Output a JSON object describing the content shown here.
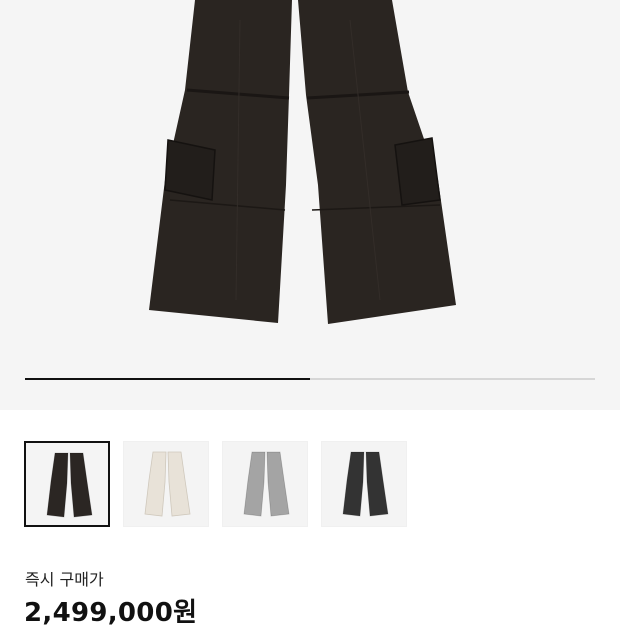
{
  "product": {
    "image_carousel": {
      "progress": 0.5
    },
    "thumbnails": [
      {
        "color_name": "black",
        "color": "#2b2623",
        "selected": true
      },
      {
        "color_name": "off-white",
        "color": "#e8e2d8",
        "selected": false
      },
      {
        "color_name": "grey",
        "color": "#a4a4a4",
        "selected": false
      },
      {
        "color_name": "washed-black",
        "color": "#333333",
        "selected": false
      }
    ],
    "price": {
      "label": "즉시 구매가",
      "value": "2,499,000원"
    }
  }
}
